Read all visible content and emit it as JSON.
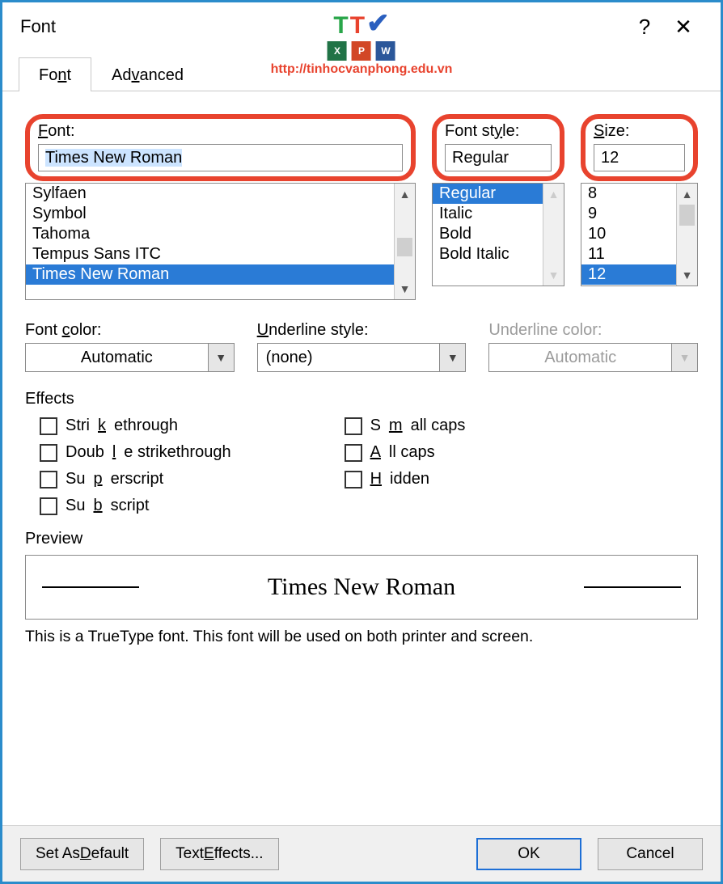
{
  "titlebar": {
    "title": "Font"
  },
  "tabs": {
    "font": "Font",
    "advanced": "Advanced"
  },
  "watermark": {
    "url": "http://tinhocvanphong.edu.vn"
  },
  "font": {
    "label": "Font:",
    "value": "Times New Roman",
    "items": [
      "Sylfaen",
      "Symbol",
      "Tahoma",
      "Tempus Sans ITC",
      "Times New Roman"
    ],
    "selected": "Times New Roman"
  },
  "style": {
    "label": "Font style:",
    "value": "Regular",
    "items": [
      "Regular",
      "Italic",
      "Bold",
      "Bold Italic"
    ],
    "selected": "Regular"
  },
  "size": {
    "label": "Size:",
    "value": "12",
    "items": [
      "8",
      "9",
      "10",
      "11",
      "12"
    ],
    "selected": "12"
  },
  "fontcolor": {
    "label": "Font color:",
    "value": "Automatic"
  },
  "underlinestyle": {
    "label": "Underline style:",
    "value": "(none)"
  },
  "underlinecolor": {
    "label": "Underline color:",
    "value": "Automatic"
  },
  "effects": {
    "label": "Effects",
    "strike": "Strikethrough",
    "dstrike": "Double strikethrough",
    "sup": "Superscript",
    "sub": "Subscript",
    "smallcaps": "Small caps",
    "allcaps": "All caps",
    "hidden": "Hidden"
  },
  "preview": {
    "label": "Preview",
    "text": "Times New Roman",
    "desc": "This is a TrueType font. This font will be used on both printer and screen."
  },
  "buttons": {
    "setdefault": "Set As Default",
    "texteffects": "Text Effects...",
    "ok": "OK",
    "cancel": "Cancel"
  }
}
